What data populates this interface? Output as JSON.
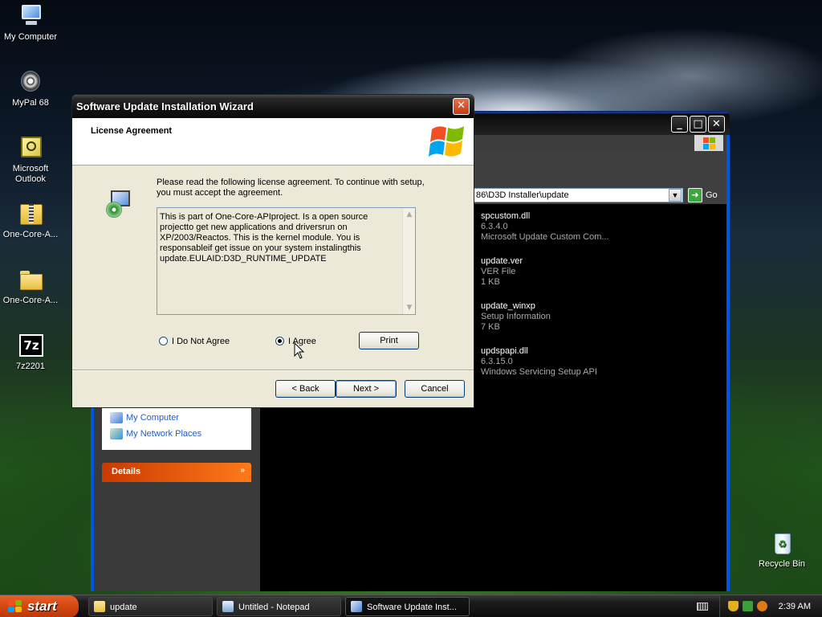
{
  "desktop": {
    "icons": [
      {
        "label": "My Computer",
        "icon": "computer-icon"
      },
      {
        "label": "MyPal 68",
        "icon": "mypal-icon"
      },
      {
        "label": "Microsoft Outlook",
        "icon": "outlook-icon"
      },
      {
        "label": "One-Core-A...",
        "icon": "zip-folder-icon"
      },
      {
        "label": "One-Core-A...",
        "icon": "folder-icon"
      },
      {
        "label": "7z2201",
        "icon": "7zip-icon"
      },
      {
        "label": "Recycle Bin",
        "icon": "recycle-bin-icon"
      }
    ]
  },
  "explorer": {
    "address": "86\\D3D Installer\\update",
    "go_label": "Go",
    "places": [
      "My Computer",
      "My Network Places"
    ],
    "details_label": "Details",
    "files": [
      {
        "name": "spcustom.dll",
        "line2": "6.3.4.0",
        "line3": "Microsoft Update Custom Com..."
      },
      {
        "name": "update.ver",
        "line2": "VER File",
        "line3": "1 KB"
      },
      {
        "name": "update_winxp",
        "line2": "Setup Information",
        "line3": "7 KB"
      },
      {
        "name": "updspapi.dll",
        "line2": "6.3.15.0",
        "line3": "Windows Servicing Setup API"
      }
    ]
  },
  "wizard": {
    "title": "Software Update Installation Wizard",
    "header_title": "License Agreement",
    "instructions": "Please read the following license agreement. To continue with setup, you must accept the agreement.",
    "license_text": "This is part of One-Core-APIproject. Is a open source projectto get new applications and driversrun on XP/2003/Reactos. This is the kernel module. You is responsableif get issue on your system instalingthis update.EULAID:D3D_RUNTIME_UPDATE",
    "radio_disagree": "I Do Not Agree",
    "radio_agree": "I Agree",
    "selected": "I Agree",
    "print_label": "Print",
    "back_label": "< Back",
    "next_label": "Next >",
    "cancel_label": "Cancel",
    "close_glyph": "✕"
  },
  "taskbar": {
    "start_label": "start",
    "tasks": [
      {
        "label": "update",
        "active": false
      },
      {
        "label": "Untitled - Notepad",
        "active": false
      },
      {
        "label": "Software Update Inst...",
        "active": true
      }
    ],
    "clock": "2:39 AM"
  },
  "colors": {
    "xp_red": "#f25022",
    "xp_green": "#7fba00",
    "xp_blue": "#00a4ef",
    "xp_yellow": "#ffb900"
  }
}
